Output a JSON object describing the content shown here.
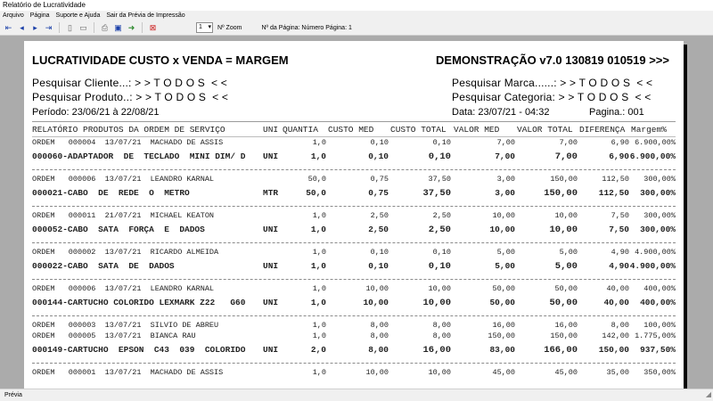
{
  "window": {
    "title": "Relatório de Lucratividade"
  },
  "menu": [
    "Arquivo",
    "Página",
    "Suporte e Ajuda",
    "Sair da Prévia de Impressão"
  ],
  "toolbar": {
    "zoom_value": "1",
    "zoom_label": "Nº Zoom",
    "page_info": "Nº da Página: Número Página: 1",
    "icons": [
      "first-page-icon",
      "prev-page-icon",
      "next-page-icon",
      "last-page-icon",
      "single-page-icon",
      "two-page-icon",
      "print-icon",
      "save-icon",
      "export-icon",
      "close-icon"
    ]
  },
  "report": {
    "title": "LUCRATIVIDADE CUSTO x VENDA = MARGEM",
    "version": "DEMONSTRAÇÃO v7.0 130819 010519 >>>",
    "filter_cliente": "Pesquisar Cliente...: > > T O D O S  < <",
    "filter_produto": "Pesquisar Produto..: > > T O D O S  < <",
    "filter_marca": "Pesquisar Marca......: > > T O D O S  < <",
    "filter_categoria": "Pesquisar Categoria: > > T O D O S  < <",
    "periodo": "Período: 23/06/21 à 22/08/21",
    "data_hora": "Data: 23/07/21 - 04:32",
    "pagina": "Pagina.: 001",
    "columns": {
      "descricao": "RELATÓRIO PRODUTOS DA ORDEM DE SERVIÇO",
      "uni": "UNI",
      "quantia": "QUANTIA",
      "custo_med": "CUSTO MED",
      "custo_total": "CUSTO TOTAL",
      "valor_med": "VALOR MED",
      "valor_total": "VALOR TOTAL",
      "diferenca": "DIFERENÇA",
      "margem": "Margem%"
    },
    "rows": [
      {
        "kind": "order",
        "desc": "ORDEM   000004  13/07/21  MACHADO DE ASSIS",
        "uni": "",
        "qtd": "1,0",
        "cmed": "0,10",
        "ctot": "0,10",
        "vmed": "7,00",
        "vtot": "7,00",
        "dif": "6,90",
        "mar": "6.900,00%"
      },
      {
        "kind": "product",
        "desc": "000060-ADAPTADOR  DE  TECLADO  MINI DIM/ D",
        "uni": "UNI",
        "qtd": "1,0",
        "cmed": "0,10",
        "ctot": "0,10",
        "vmed": "7,00",
        "vtot": "7,00",
        "dif": "6,90",
        "mar": "6.900,00%"
      },
      {
        "kind": "gap"
      },
      {
        "kind": "order",
        "desc": "ORDEM   000006  13/07/21  LEANDRO KARNAL",
        "uni": "",
        "qtd": "50,0",
        "cmed": "0,75",
        "ctot": "37,50",
        "vmed": "3,00",
        "vtot": "150,00",
        "dif": "112,50",
        "mar": "300,00%"
      },
      {
        "kind": "product",
        "desc": "000021-CABO  DE  REDE  O  METRO",
        "uni": "MTR",
        "qtd": "50,0",
        "cmed": "0,75",
        "ctot": "37,50",
        "vmed": "3,00",
        "vtot": "150,00",
        "dif": "112,50",
        "mar": "300,00%"
      },
      {
        "kind": "gap"
      },
      {
        "kind": "order",
        "desc": "ORDEM   000011  21/07/21  MICHAEL KEATON",
        "uni": "",
        "qtd": "1,0",
        "cmed": "2,50",
        "ctot": "2,50",
        "vmed": "10,00",
        "vtot": "10,00",
        "dif": "7,50",
        "mar": "300,00%"
      },
      {
        "kind": "product",
        "desc": "000052-CABO  SATA  FORÇA  E  DADOS",
        "uni": "UNI",
        "qtd": "1,0",
        "cmed": "2,50",
        "ctot": "2,50",
        "vmed": "10,00",
        "vtot": "10,00",
        "dif": "7,50",
        "mar": "300,00%"
      },
      {
        "kind": "gap"
      },
      {
        "kind": "order",
        "desc": "ORDEM   000002  13/07/21  RICARDO ALMEIDA",
        "uni": "",
        "qtd": "1,0",
        "cmed": "0,10",
        "ctot": "0,10",
        "vmed": "5,00",
        "vtot": "5,00",
        "dif": "4,90",
        "mar": "4.900,00%"
      },
      {
        "kind": "product",
        "desc": "000022-CABO  SATA  DE  DADOS",
        "uni": "UNI",
        "qtd": "1,0",
        "cmed": "0,10",
        "ctot": "0,10",
        "vmed": "5,00",
        "vtot": "5,00",
        "dif": "4,90",
        "mar": "4.900,00%"
      },
      {
        "kind": "gap"
      },
      {
        "kind": "order",
        "desc": "ORDEM   000006  13/07/21  LEANDRO KARNAL",
        "uni": "",
        "qtd": "1,0",
        "cmed": "10,00",
        "ctot": "10,00",
        "vmed": "50,00",
        "vtot": "50,00",
        "dif": "40,00",
        "mar": "400,00%"
      },
      {
        "kind": "product",
        "desc": "000144-CARTUCHO COLORIDO LEXMARK Z22   G60",
        "uni": "UNI",
        "qtd": "1,0",
        "cmed": "10,00",
        "ctot": "10,00",
        "vmed": "50,00",
        "vtot": "50,00",
        "dif": "40,00",
        "mar": "400,00%"
      },
      {
        "kind": "gap"
      },
      {
        "kind": "order",
        "desc": "ORDEM   000003  13/07/21  SILVIO DE ABREU",
        "uni": "",
        "qtd": "1,0",
        "cmed": "8,00",
        "ctot": "8,00",
        "vmed": "16,00",
        "vtot": "16,00",
        "dif": "8,00",
        "mar": "100,00%"
      },
      {
        "kind": "order",
        "desc": "ORDEM   000005  13/07/21  BIANCA RAU",
        "uni": "",
        "qtd": "1,0",
        "cmed": "8,00",
        "ctot": "8,00",
        "vmed": "150,00",
        "vtot": "150,00",
        "dif": "142,00",
        "mar": "1.775,00%"
      },
      {
        "kind": "product",
        "desc": "000149-CARTUCHO  EPSON  C43  039  COLORIDO",
        "uni": "UNI",
        "qtd": "2,0",
        "cmed": "8,00",
        "ctot": "16,00",
        "vmed": "83,00",
        "vtot": "166,00",
        "dif": "150,00",
        "mar": "937,50%"
      },
      {
        "kind": "gap"
      },
      {
        "kind": "order",
        "desc": "ORDEM   000001  13/07/21  MACHADO DE ASSIS",
        "uni": "",
        "qtd": "1,0",
        "cmed": "10,00",
        "ctot": "10,00",
        "vmed": "45,00",
        "vtot": "45,00",
        "dif": "35,00",
        "mar": "350,00%"
      }
    ]
  },
  "status": {
    "text": "Prévia"
  }
}
